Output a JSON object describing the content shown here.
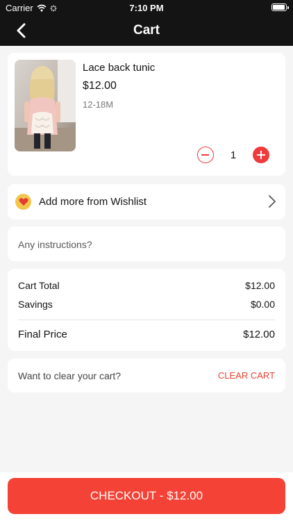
{
  "status_bar": {
    "carrier": "Carrier",
    "time": "7:10 PM"
  },
  "nav": {
    "title": "Cart"
  },
  "cart_item": {
    "name": "Lace back tunic",
    "price": "$12.00",
    "size": "12-18M",
    "quantity": "1"
  },
  "wishlist": {
    "label": "Add more from Wishlist"
  },
  "instructions": {
    "placeholder": "Any instructions?"
  },
  "summary": {
    "cart_total_label": "Cart Total",
    "cart_total_value": "$12.00",
    "savings_label": "Savings",
    "savings_value": "$0.00",
    "final_label": "Final Price",
    "final_value": "$12.00"
  },
  "clear": {
    "question": "Want to clear your cart?",
    "button": "CLEAR CART"
  },
  "checkout": {
    "label": "CHECKOUT - $12.00"
  },
  "colors": {
    "accent": "#f44336",
    "header": "#141414",
    "heart_bg": "#f2c54b"
  }
}
